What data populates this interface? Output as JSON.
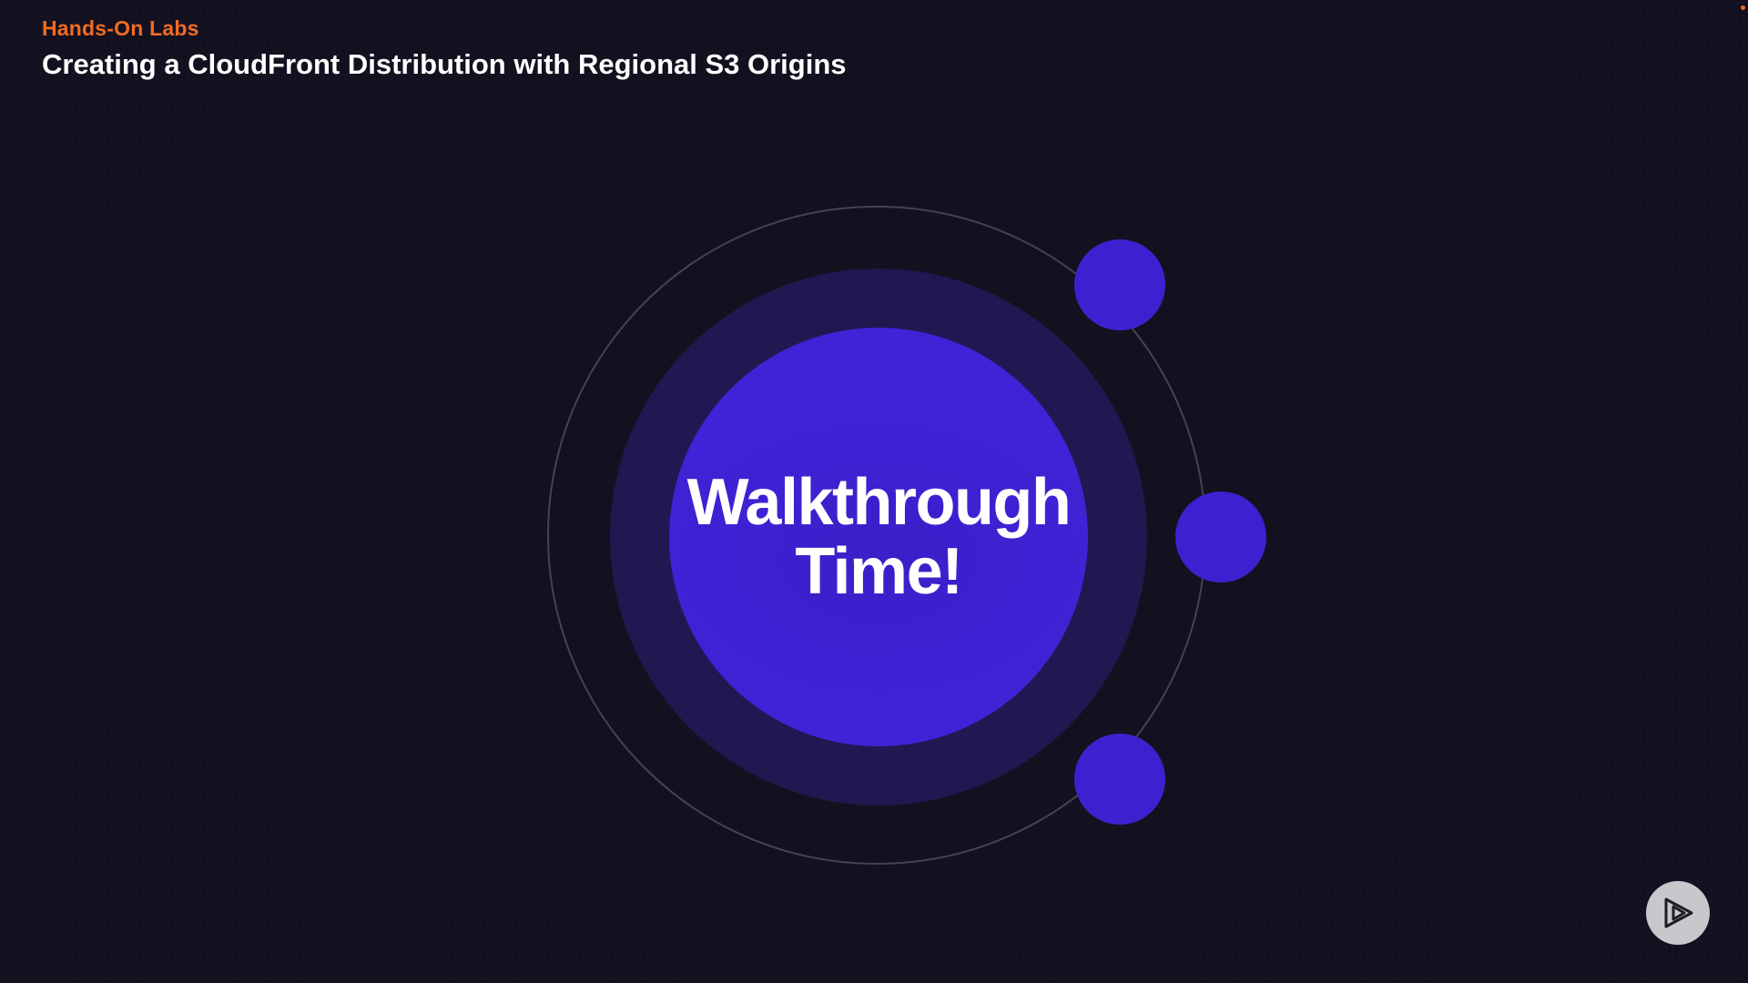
{
  "header": {
    "subtitle": "Hands-On Labs",
    "title": "Creating a CloudFront Distribution with Regional S3 Origins"
  },
  "slide": {
    "line1": "Walkthrough",
    "line2": "Time!"
  },
  "player": {
    "play_icon": "play-icon"
  },
  "colors": {
    "background": "#13111f",
    "accent_orange": "#f26b21",
    "primary_purple": "#3d21d0",
    "halo_purple": "#201850",
    "orbit_ring": "#45434f"
  }
}
